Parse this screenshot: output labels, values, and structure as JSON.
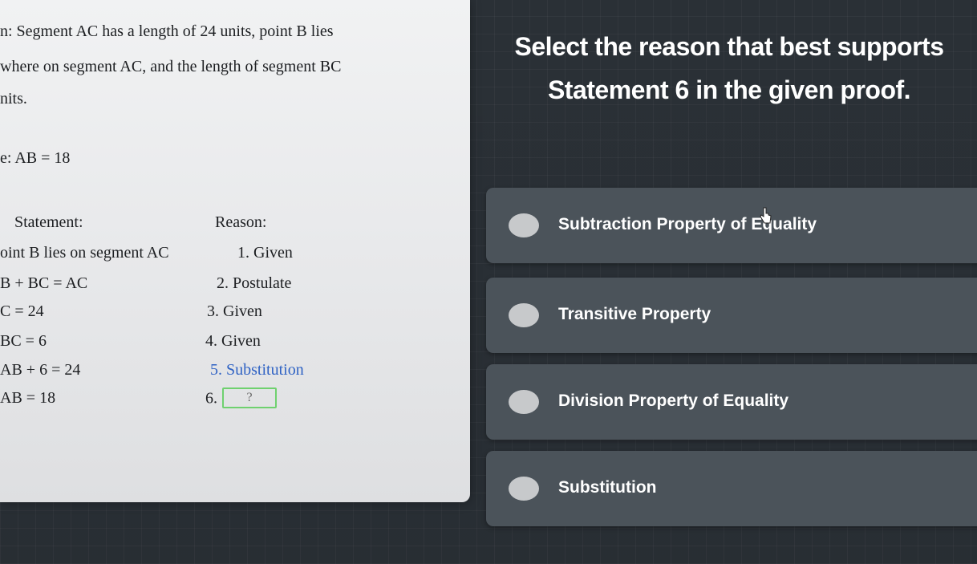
{
  "given": {
    "line1": "n: Segment AC has a length of 24 units, point B lies",
    "line2": "where on segment AC, and the length of segment BC",
    "line3": "nits."
  },
  "prove": "e: AB = 18",
  "table": {
    "statement_header": "Statement:",
    "reason_header": "Reason:",
    "rows": [
      {
        "statement": "oint B lies on segment AC",
        "reason": "1. Given"
      },
      {
        "statement": "B + BC = AC",
        "reason": "2. Postulate"
      },
      {
        "statement": "C = 24",
        "reason": "3. Given"
      },
      {
        "statement": "BC = 6",
        "reason": "4. Given"
      },
      {
        "statement": "AB + 6 = 24",
        "reason": "5. Substitution"
      },
      {
        "statement": "AB = 18",
        "reason_prefix": "6.",
        "reason_blank": "?"
      }
    ]
  },
  "question": {
    "line1": "Select the reason that best supports",
    "line2": "Statement 6 in the given proof."
  },
  "options": [
    {
      "label": "Subtraction Property of Equality"
    },
    {
      "label": "Transitive Property"
    },
    {
      "label": "Division Property of Equality"
    },
    {
      "label": "Substitution"
    }
  ],
  "colors": {
    "background": "#2b3238",
    "option_bg": "#4b535a",
    "answer_box_border": "#6fd16f",
    "substitution_blue": "#2f62c4"
  }
}
